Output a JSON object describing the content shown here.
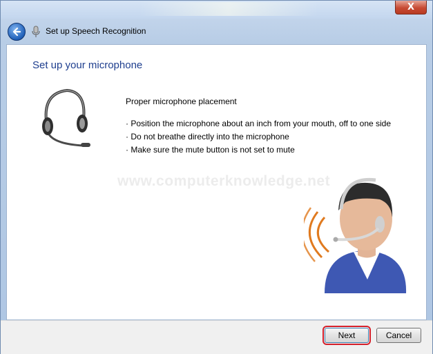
{
  "window": {
    "close_label": "X"
  },
  "nav": {
    "back_icon": "back-arrow-icon",
    "app_icon": "microphone-icon",
    "title": "Set up Speech Recognition"
  },
  "content": {
    "heading": "Set up your microphone",
    "subheading": "Proper microphone placement",
    "bullets": [
      "Position the microphone about an inch from your mouth, off to one side",
      "Do not breathe directly into the microphone",
      "Make sure the mute button is not set to mute"
    ],
    "watermark": "www.computerknowledge.net"
  },
  "footer": {
    "next_label": "Next",
    "cancel_label": "Cancel"
  },
  "colors": {
    "heading": "#1e3e8e",
    "highlight_outline": "#d6202a"
  }
}
